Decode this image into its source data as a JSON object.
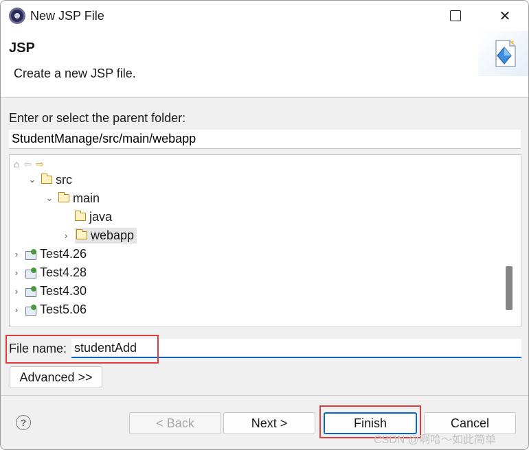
{
  "window": {
    "title": "New JSP File"
  },
  "header": {
    "title": "JSP",
    "description": "Create a new JSP file."
  },
  "folder": {
    "label": "Enter or select the parent folder:",
    "value": "StudentManage/src/main/webapp"
  },
  "tree": {
    "items": [
      {
        "label": "src",
        "icon": "folder-icon",
        "expanded": true
      },
      {
        "label": "main",
        "icon": "folder-icon",
        "expanded": true
      },
      {
        "label": "java",
        "icon": "folder-icon"
      },
      {
        "label": "webapp",
        "icon": "folder-icon",
        "selected": true
      },
      {
        "label": "Test4.26",
        "icon": "project-icon"
      },
      {
        "label": "Test4.28",
        "icon": "project-icon"
      },
      {
        "label": "Test4.30",
        "icon": "project-icon"
      },
      {
        "label": "Test5.06",
        "icon": "project-icon"
      }
    ]
  },
  "file": {
    "label": "File name:",
    "value": "studentAdd"
  },
  "buttons": {
    "advanced": "Advanced >>",
    "back": "< Back",
    "next": "Next >",
    "finish": "Finish",
    "cancel": "Cancel"
  },
  "watermark": "CSDN @啊哈～如此简单",
  "colors": {
    "accent": "#0a64c8",
    "highlight_box": "#e03a3a"
  }
}
